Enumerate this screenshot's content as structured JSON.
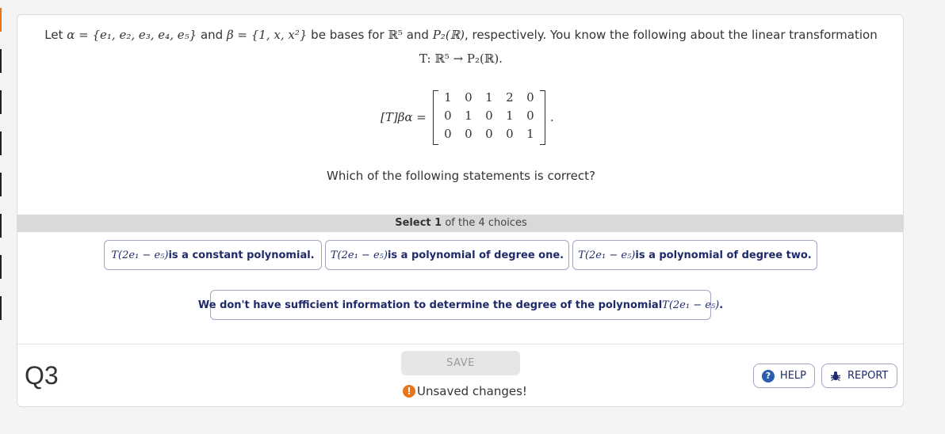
{
  "problem": {
    "intro": "Let",
    "alpha_set": "α = {e₁, e₂, e₃, e₄, e₅}",
    "and1": "and",
    "beta_set": "β = {1, x, x²}",
    "be_bases": "be bases for",
    "R5": "ℝ⁵",
    "and2": "and",
    "P2": "P₂(ℝ)",
    "tail": ", respectively. You know the following about the linear transformation",
    "mapping": "T: ℝ⁵ → P₂(ℝ).",
    "matrix_lhs": "[T]βα =",
    "matrix": [
      [
        1,
        0,
        1,
        2,
        0
      ],
      [
        0,
        1,
        0,
        1,
        0
      ],
      [
        0,
        0,
        0,
        0,
        1
      ]
    ],
    "question": "Which of the following statements is correct?"
  },
  "select_bar": {
    "strong": "Select 1",
    "rest": " of the 4 choices"
  },
  "choices": [
    {
      "math": "T(2e₁ − e₅)",
      "text": " is a constant polynomial."
    },
    {
      "math": "T(2e₁ − e₅)",
      "text": " is a polynomial of degree one."
    },
    {
      "math": "T(2e₁ − e₅)",
      "text": " is a polynomial of degree two."
    },
    {
      "text": "We don't have sufficient information to determine the degree of the polynomial ",
      "math": "T(2e₁ − e₅)",
      "end": "."
    }
  ],
  "footer": {
    "qnum": "Q3",
    "save_label": "SAVE",
    "unsaved": "Unsaved changes!",
    "help": "HELP",
    "report": "REPORT"
  },
  "icons": {
    "warning": "warning-icon",
    "help": "help-icon",
    "report": "bug-icon"
  },
  "colors": {
    "accent": "#e8751a",
    "choice_text": "#1f2a6b",
    "help_blue": "#2a5db0"
  }
}
